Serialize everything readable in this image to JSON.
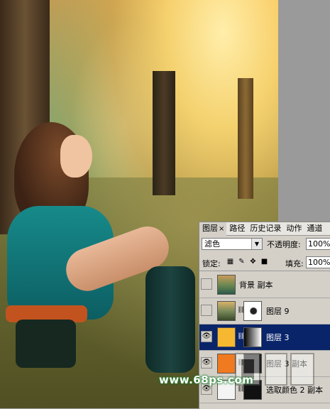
{
  "panel": {
    "tabs": [
      {
        "label": "图层",
        "active": true
      },
      {
        "label": "路径",
        "active": false
      },
      {
        "label": "历史记录",
        "active": false
      },
      {
        "label": "动作",
        "active": false
      },
      {
        "label": "通道",
        "active": false
      }
    ],
    "tab_close": "×",
    "blend_mode": "滤色",
    "opacity_label": "不透明度:",
    "opacity_value": "100%",
    "lock_label": "锁定:",
    "fill_label": "填充:",
    "fill_value": "100%",
    "layers": [
      {
        "name": "背景 副本",
        "visible": false,
        "selected": false
      },
      {
        "name": "图层 9",
        "visible": false,
        "selected": false
      },
      {
        "name": "图层 3",
        "visible": true,
        "selected": true
      },
      {
        "name": "图层 3 副本",
        "visible": true,
        "selected": false
      },
      {
        "name": "选取颜色 2 副本",
        "visible": true,
        "selected": false
      }
    ]
  },
  "watermark": {
    "url": "www.68ps.com"
  },
  "colors": {
    "selection": "#0a246a",
    "panel_bg": "#d4d0c8"
  }
}
